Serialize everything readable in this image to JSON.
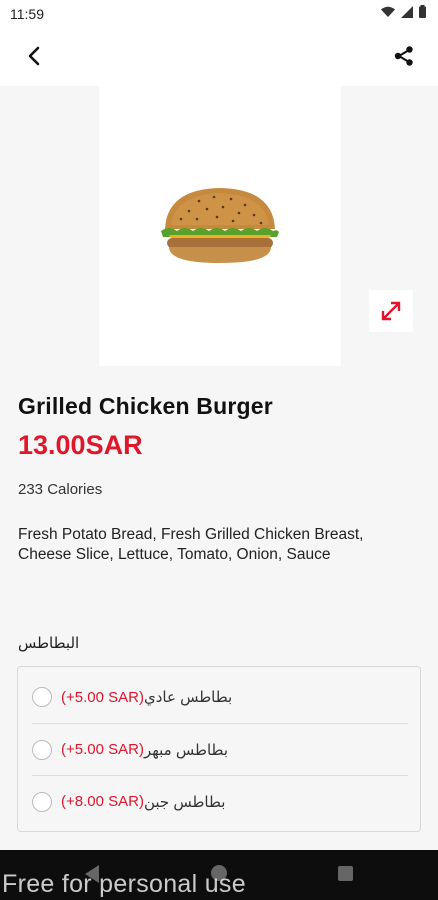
{
  "status_bar": {
    "time": "11:59"
  },
  "app_bar": {
    "back_icon": "chevron-left-icon",
    "share_icon": "share-icon"
  },
  "product": {
    "name": "Grilled Chicken Burger",
    "price": "13.00SAR",
    "calories": "233 Calories",
    "description": "Fresh Potato Bread, Fresh Grilled Chicken Breast, Cheese Slice, Lettuce, Tomato, Onion, Sauce",
    "image_alt": "burger-image",
    "expand_icon": "expand-icon"
  },
  "options": {
    "group_title": "البطاطس",
    "items": [
      {
        "label": "بطاطس عادي",
        "price": "(+5.00 SAR)"
      },
      {
        "label": "بطاطس مبهر",
        "price": "(+5.00 SAR)"
      },
      {
        "label": "بطاطس جبن",
        "price": "(+8.00 SAR)"
      }
    ]
  },
  "watermark": "Free for personal use",
  "colors": {
    "accent": "#e0162b",
    "background": "#f6f6f6",
    "nav": "#0d0d0d"
  }
}
